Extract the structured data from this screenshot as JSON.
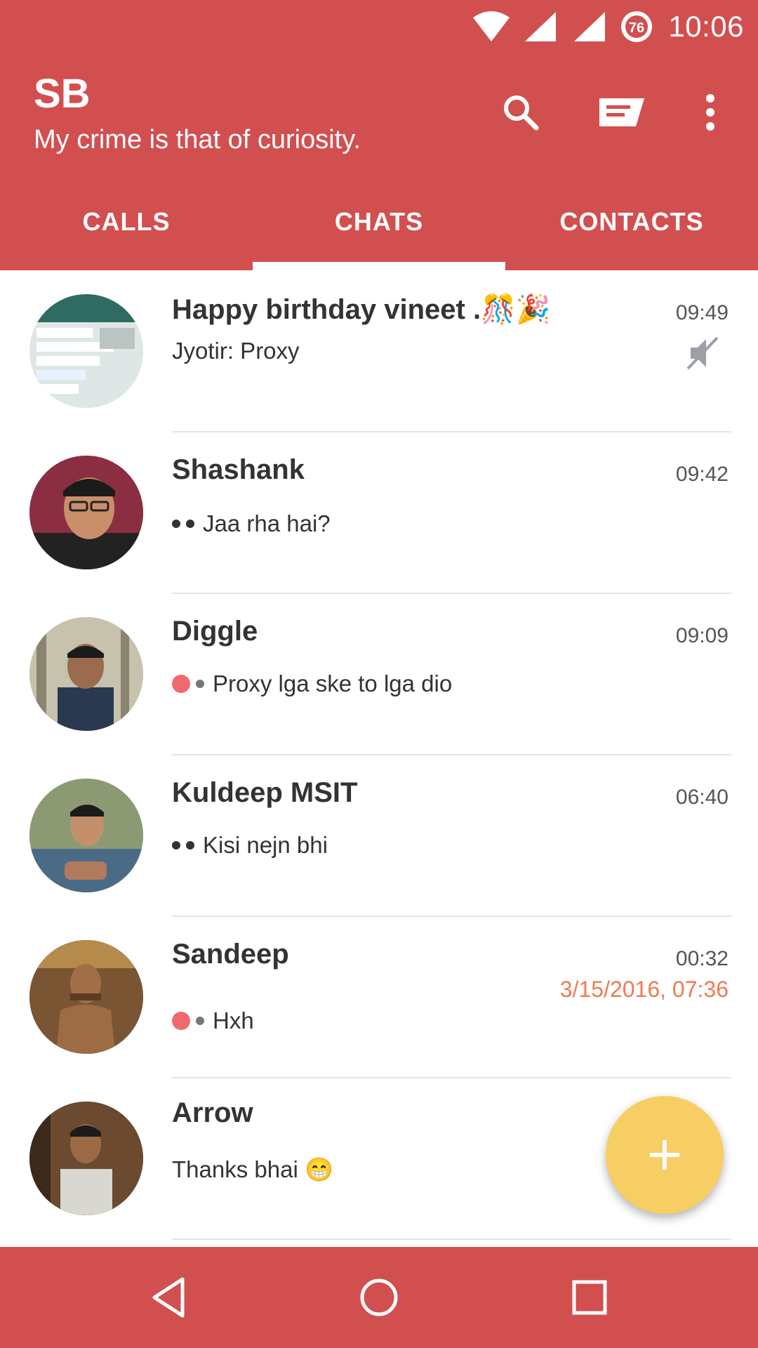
{
  "status_bar": {
    "time": "10:06",
    "battery_level": "76",
    "icons": [
      "wifi-icon",
      "signal-icon",
      "signal-icon",
      "battery-icon"
    ]
  },
  "app_bar": {
    "title": "SB",
    "subtitle": "My crime is that of curiosity.",
    "actions": [
      "search-icon",
      "new-chat-icon",
      "more-vert-icon"
    ]
  },
  "tabs": [
    {
      "label": "CALLS",
      "selected": false
    },
    {
      "label": "CHATS",
      "selected": true
    },
    {
      "label": "CONTACTS",
      "selected": false
    }
  ],
  "chats": [
    {
      "name": "Happy birthday vineet .🎊🎉",
      "time": "09:49",
      "preview": "Jyotir:  Proxy",
      "muted": true
    },
    {
      "name": "Shashank",
      "time": "09:42",
      "preview": "Jaa rha hai?"
    },
    {
      "name": "Diggle",
      "time": "09:09",
      "preview": "Proxy lga ske to lga dio"
    },
    {
      "name": "Kuldeep MSIT",
      "time": "06:40",
      "preview": "Kisi nejn bhi"
    },
    {
      "name": "Sandeep",
      "time": "00:32",
      "extra_date": "3/15/2016, 07:36",
      "preview": "Hxh"
    },
    {
      "name": "Arrow",
      "time": "",
      "preview": "Thanks bhai 😁"
    }
  ],
  "fab": {
    "icon": "plus-icon"
  },
  "nav_bar": {
    "buttons": [
      "back-icon",
      "home-icon",
      "recents-icon"
    ]
  },
  "colors": {
    "primary": "#d24f50",
    "fab": "#f6ce63",
    "unread_dot": "#ef6a6e",
    "date_highlight": "#f07a52"
  }
}
